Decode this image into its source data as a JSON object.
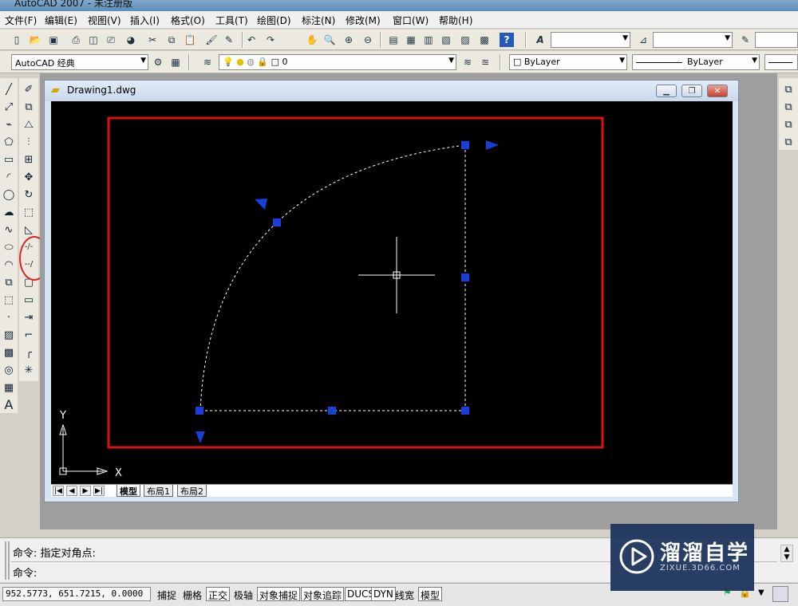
{
  "window": {
    "title": "AutoCAD 2007 - 未注册版"
  },
  "menu": [
    "文件(F)",
    "编辑(E)",
    "视图(V)",
    "插入(I)",
    "格式(O)",
    "工具(T)",
    "绘图(D)",
    "标注(N)",
    "修改(M)",
    "窗口(W)",
    "帮助(H)"
  ],
  "toolbar": {
    "workspace": "AutoCAD 经典",
    "layer_value": "0",
    "color_value": "ByLayer",
    "linetype_value": "ByLayer"
  },
  "icons": {
    "standard": [
      "new-icon",
      "open-icon",
      "save-icon",
      "print-icon",
      "preview-icon",
      "publish-icon",
      "3d-dwf-icon",
      "cut-icon",
      "copy-icon",
      "paste-icon",
      "match-properties-icon",
      "block-editor-icon",
      "undo-icon",
      "redo-icon",
      "pan-icon",
      "zoom-realtime-icon",
      "zoom-window-icon",
      "zoom-previous-icon",
      "properties-icon",
      "design-center-icon",
      "tool-palettes-icon",
      "sheet-set-icon",
      "markup-icon",
      "calculator-icon",
      "help-icon"
    ],
    "draw": [
      "line-icon",
      "construction-line-icon",
      "polyline-icon",
      "polygon-icon",
      "rectangle-icon",
      "arc-icon",
      "circle-icon",
      "revision-cloud-icon",
      "spline-icon",
      "ellipse-icon",
      "ellipse-arc-icon",
      "insert-block-icon",
      "make-block-icon",
      "point-icon",
      "hatch-icon",
      "gradient-icon",
      "region-icon",
      "table-icon",
      "multiline-text-icon"
    ],
    "modify": [
      "erase-icon",
      "copy-object-icon",
      "mirror-icon",
      "offset-icon",
      "array-icon",
      "move-icon",
      "rotate-icon",
      "scale-icon",
      "stretch-icon",
      "trim-icon",
      "extend-icon",
      "break-at-point-icon",
      "break-icon",
      "join-icon",
      "chamfer-icon",
      "fillet-icon",
      "explode-icon"
    ]
  },
  "document": {
    "title": "Drawing1.dwg",
    "ucs_x": "X",
    "ucs_y": "Y",
    "tabs": [
      "模型",
      "布局1",
      "布局2"
    ]
  },
  "command": {
    "history": "命令: 指定对角点:",
    "prompt": "命令:"
  },
  "status": {
    "coords": "952.5773, 651.7215, 0.0000",
    "buttons": [
      {
        "label": "捕捉",
        "on": false
      },
      {
        "label": "栅格",
        "on": false
      },
      {
        "label": "正交",
        "on": true
      },
      {
        "label": "极轴",
        "on": false
      },
      {
        "label": "对象捕捉",
        "on": true
      },
      {
        "label": "对象追踪",
        "on": true
      },
      {
        "label": "DUCS",
        "on": true
      },
      {
        "label": "DYN",
        "on": true
      },
      {
        "label": "线宽",
        "on": false
      },
      {
        "label": "模型",
        "on": true
      }
    ]
  },
  "watermark": {
    "name": "溜溜自学",
    "site": "ZIXUE.3D66.COM"
  },
  "colors": {
    "highlight": "#dd1111",
    "grip": "#1a3fd8",
    "canvas": "#000000"
  }
}
